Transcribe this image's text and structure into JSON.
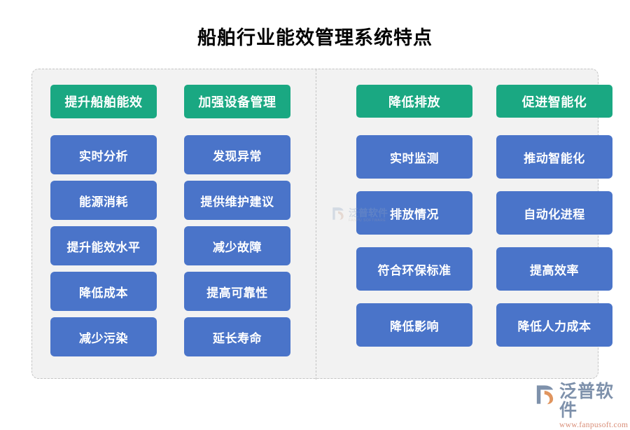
{
  "page": {
    "title": "船舶行业能效管理系统特点",
    "background_color": "#ffffff"
  },
  "theme": {
    "header_green": "#1aa882",
    "item_blue": "#4a74c9",
    "frame_background": "#f2f2f2",
    "frame_border": "#c4c4c4",
    "title_color": "#000000"
  },
  "panels": [
    {
      "id": "left",
      "columns": [
        {
          "header": "提升船舶能效",
          "items": [
            "实时分析",
            "能源消耗",
            "提升能效水平",
            "降低成本",
            "减少污染"
          ]
        },
        {
          "header": "加强设备管理",
          "items": [
            "发现异常",
            "提供维护建议",
            "减少故障",
            "提高可靠性",
            "延长寿命"
          ]
        }
      ]
    },
    {
      "id": "right",
      "columns": [
        {
          "header": "降低排放",
          "items": [
            "实时监测",
            "排放情况",
            "符合环保标准",
            "降低影响"
          ]
        },
        {
          "header": "促进智能化",
          "items": [
            "推动智能化",
            "自动化进程",
            "提高效率",
            "降低人力成本"
          ]
        }
      ]
    }
  ],
  "branding": {
    "name": "泛普软件",
    "url": "www.fanpusoft.com",
    "name_color": "#7e91ab",
    "url_color": "#d98e78"
  },
  "watermark": {
    "name": "泛普软件",
    "url": "FANPU SOFTWARE"
  }
}
